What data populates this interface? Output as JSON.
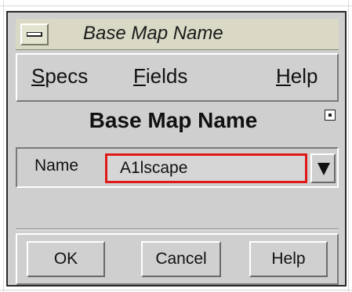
{
  "window": {
    "title": "Base Map Name"
  },
  "menubar": {
    "items": [
      {
        "pre": "",
        "mnemonic": "S",
        "post": "pecs"
      },
      {
        "pre": "",
        "mnemonic": "F",
        "post": "ields"
      },
      {
        "pre": "",
        "mnemonic": "H",
        "post": "elp"
      }
    ]
  },
  "content": {
    "title": "Base Map Name"
  },
  "name_field": {
    "label": "Name",
    "value": "A1lscape"
  },
  "buttons": {
    "ok": "OK",
    "cancel": "Cancel",
    "help": "Help"
  },
  "colors": {
    "highlight_border": "#e01818",
    "titlebar_bg": "#d9d9c6",
    "window_bg": "#cfcfcf"
  },
  "icons": {
    "window_menu": "window-menu-icon",
    "dropdown": "triangle-down-icon",
    "resize": "resize-icon"
  }
}
